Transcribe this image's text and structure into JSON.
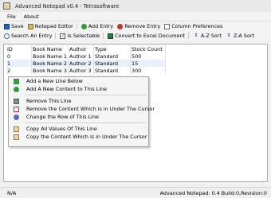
{
  "window": {
    "title": "Advanced Notepad v0.4 - Tetrasoftware"
  },
  "menu": {
    "file": "File",
    "about": "About"
  },
  "toolbar": {
    "row1": [
      {
        "label": "Save",
        "icon": "save-icon"
      },
      {
        "label": "Notepad Editor",
        "icon": "notepad-icon"
      },
      {
        "label": "Add Entry",
        "icon": "add-icon"
      },
      {
        "label": "Remove Entry",
        "icon": "remove-icon"
      },
      {
        "label": "Column Preferences",
        "icon": "columns-icon"
      }
    ],
    "row2": [
      {
        "label": "Search An Entry",
        "icon": "search-icon"
      },
      {
        "label": "Is Selectable",
        "icon": "checkbox-icon",
        "glyph": "✓"
      },
      {
        "label": "Convert to Excel Document",
        "icon": "excel-icon"
      },
      {
        "label": "A-Z Sort",
        "icon": "sort-az-icon",
        "glyph": "↕"
      },
      {
        "label": "Z-A Sort",
        "icon": "sort-za-icon",
        "glyph": "↕"
      }
    ]
  },
  "table": {
    "columns": [
      "ID",
      "Book Name",
      "Author",
      "Type",
      "Stock Count"
    ],
    "rows": [
      [
        "0",
        "Book Name 1",
        "Author 1",
        "Standard",
        "500"
      ],
      [
        "1",
        "Book Name 2",
        "Author 2",
        "Standard",
        "15"
      ],
      [
        "2",
        "Book Name 3",
        "Author 3",
        "Standard",
        "300"
      ]
    ],
    "selected_row": 1
  },
  "context_menu": {
    "groups": [
      [
        {
          "label": "Add a New Line Below",
          "icon": "download-arrow-icon"
        },
        {
          "label": "Add A New Content to This Line",
          "icon": "add-plus-icon"
        }
      ],
      [
        {
          "label": "Remove This Line",
          "icon": "trash-icon"
        },
        {
          "label": "Remove the Content Which is in Under The Cursor",
          "icon": "remove-content-icon"
        },
        {
          "label": "Change the Row of This Line",
          "icon": "change-row-icon"
        }
      ],
      [
        {
          "label": "Copy All Values Of This Line",
          "icon": "copy-icon"
        },
        {
          "label": "Copy the Content Which is in Under The Cursor",
          "icon": "copy-content-icon"
        }
      ]
    ]
  },
  "status": {
    "left": "N/A",
    "right": "Advanced Notepad: 0.4 Build:0,Revision:0"
  },
  "colors": {
    "selected_row": "#e8f0fb",
    "window_bg": "#f0f0f0"
  }
}
